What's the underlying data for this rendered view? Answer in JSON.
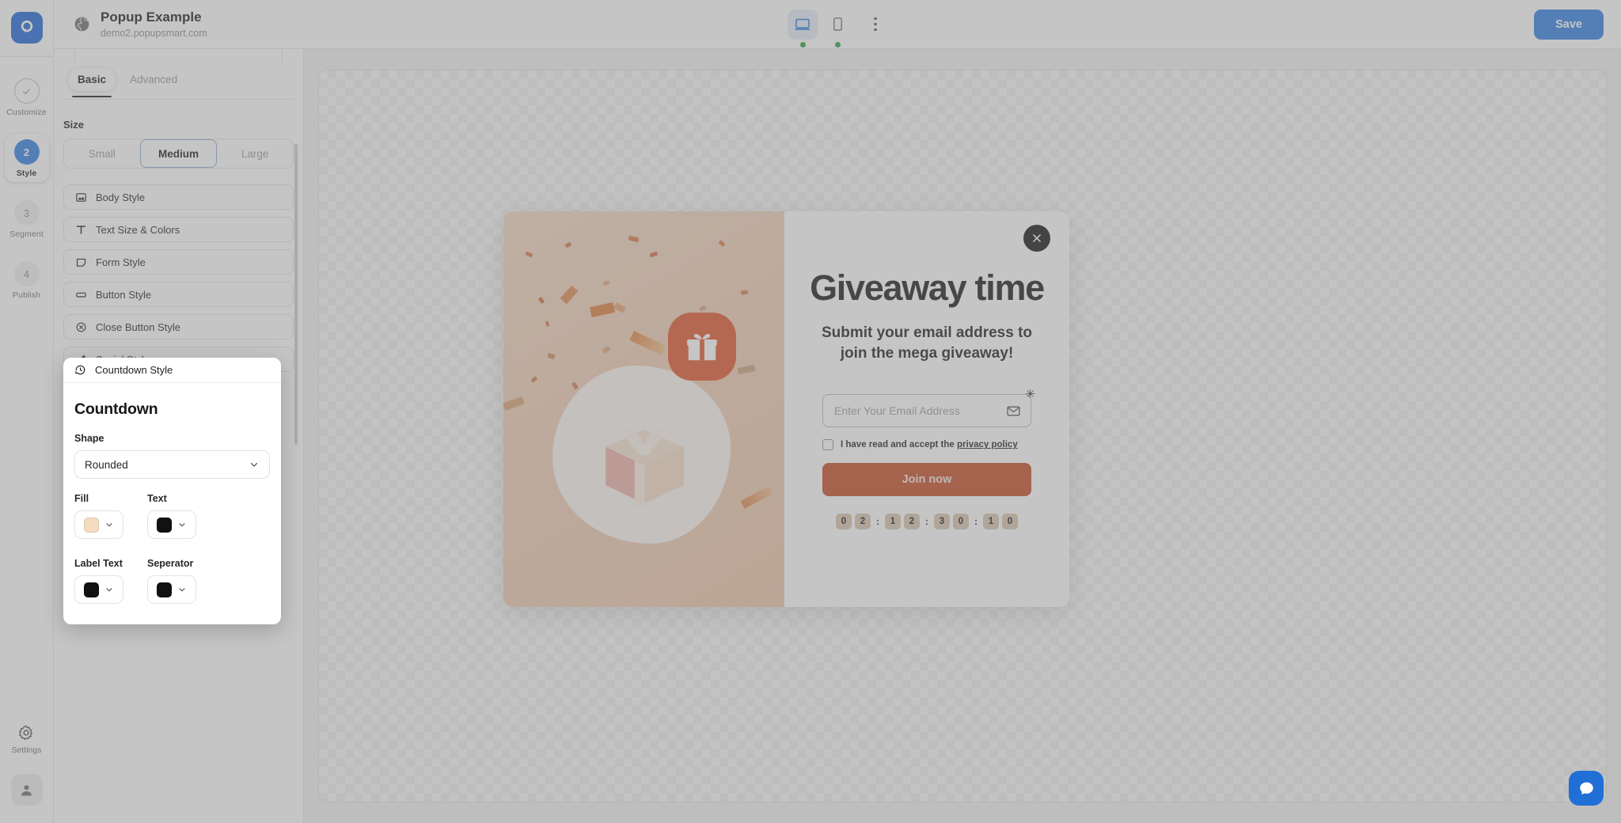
{
  "brand": {
    "logo_icon": "popupsmart-logo-icon",
    "accent_color": "#1c64d9"
  },
  "rail": {
    "steps": [
      {
        "label": "Customize",
        "badge": "check",
        "icon": "check-icon",
        "active": false
      },
      {
        "label": "Style",
        "badge": "2",
        "active": true
      },
      {
        "label": "Segment",
        "badge": "3",
        "active": false
      },
      {
        "label": "Publish",
        "badge": "4",
        "active": false
      }
    ],
    "settings_label": "Settings",
    "settings_icon": "gear-icon",
    "avatar_icon": "avatar-icon"
  },
  "header": {
    "globe_icon": "globe-icon",
    "site_title": "Popup Example",
    "site_url": "demo2.popupsmart.com",
    "devices": [
      {
        "name": "desktop",
        "icon": "desktop-icon",
        "active": true,
        "status": "online"
      },
      {
        "name": "mobile",
        "icon": "mobile-icon",
        "active": false,
        "status": "online"
      }
    ],
    "more_icon": "kebab-menu-icon",
    "save_label": "Save",
    "save_color": "#2f7fe4"
  },
  "panel": {
    "tabs": [
      {
        "label": "Basic",
        "active": true
      },
      {
        "label": "Advanced",
        "active": false
      }
    ],
    "size_label": "Size",
    "size_options": [
      {
        "label": "Small",
        "active": false
      },
      {
        "label": "Medium",
        "active": true
      },
      {
        "label": "Large",
        "active": false
      }
    ],
    "accordions": [
      {
        "label": "Body Style",
        "icon": "image-icon"
      },
      {
        "label": "Text Size & Colors",
        "icon": "text-icon"
      },
      {
        "label": "Form Style",
        "icon": "form-icon"
      },
      {
        "label": "Button Style",
        "icon": "button-icon"
      },
      {
        "label": "Close Button Style",
        "icon": "close-circle-icon"
      },
      {
        "label": "Social Style",
        "icon": "share-icon"
      }
    ]
  },
  "countdown_panel": {
    "header_label": "Countdown Style",
    "header_icon": "history-clock-icon",
    "title": "Countdown",
    "shape_label": "Shape",
    "shape_value": "Rounded",
    "colors": [
      {
        "label": "Fill",
        "value": "#f5dcbe"
      },
      {
        "label": "Text",
        "value": "#111114"
      },
      {
        "label": "Label Text",
        "value": "#111114"
      },
      {
        "label": "Seperator",
        "value": "#111114"
      }
    ]
  },
  "popup": {
    "close_icon": "close-icon",
    "gift_badge_icon": "gift-icon",
    "gift_image_icon": "gift-box-3d-icon",
    "title": "Giveaway time",
    "subtitle": "Submit your email address to join the mega giveaway!",
    "email_placeholder": "Enter Your Email Address",
    "email_value": "",
    "email_icon": "envelope-icon",
    "required_mark": "✳",
    "consent_prefix": "I have read and accept the ",
    "consent_link": "privacy policy",
    "cta_label": "Join now",
    "cta_color": "#c44a22",
    "countdown": {
      "groups": [
        [
          "0",
          "2"
        ],
        [
          "1",
          "2"
        ],
        [
          "3",
          "0"
        ],
        [
          "1",
          "0"
        ]
      ],
      "separator": ":",
      "fill_color": "#d9c4ad"
    }
  },
  "chat": {
    "icon": "chat-bubble-icon",
    "color": "#1f6fd6"
  }
}
